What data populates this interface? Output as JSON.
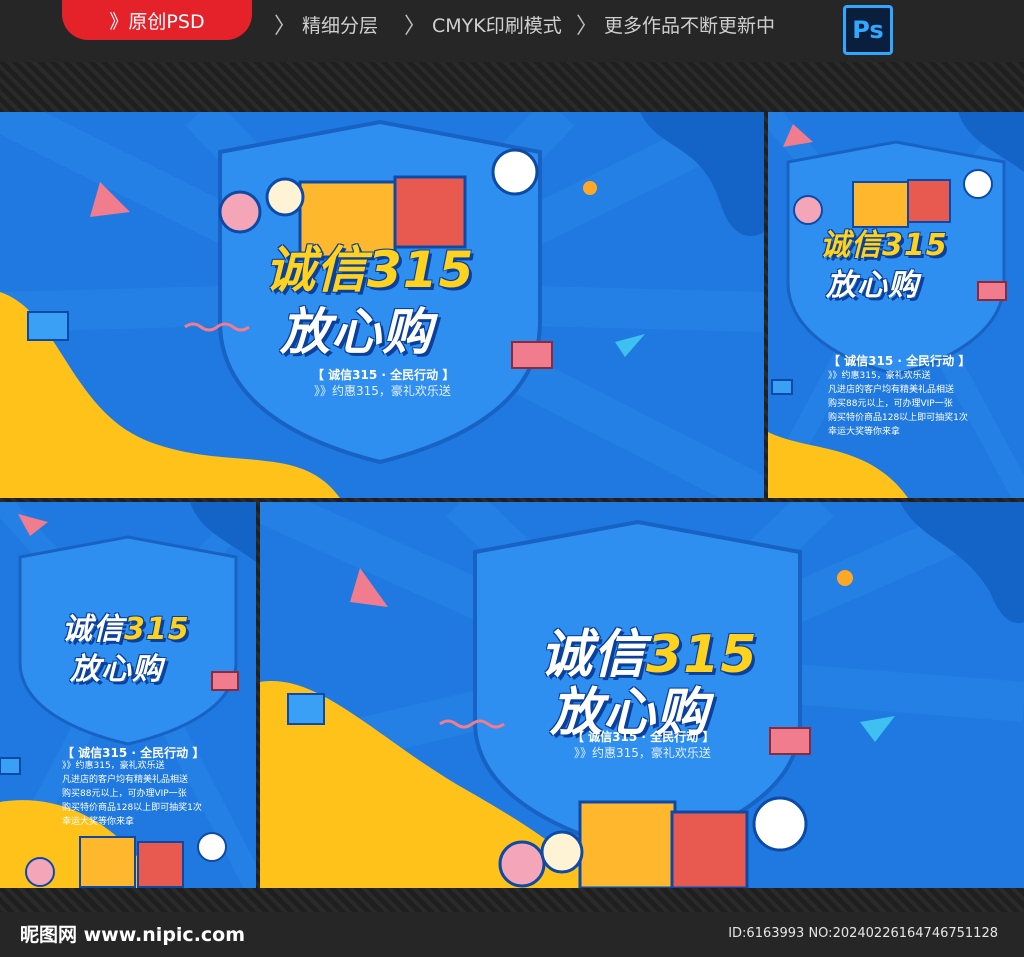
{
  "header": {
    "badge": "》原创PSD",
    "features": [
      "精细分层",
      "CMYK印刷模式",
      "更多作品不断更新中"
    ],
    "ps_label": "Ps"
  },
  "poster": {
    "title_a": "诚信",
    "title_b": "315",
    "title_line2": "放心购",
    "subtitle": "【 诚信315 · 全民行动 】",
    "tagline": "》》约惠315，豪礼欢乐送",
    "list": [
      "》》约惠315，豪礼欢乐送",
      "凡进店的客户均有精美礼品相送",
      "购买88元以上，可办理VIP一张",
      "购买特价商品128以上即可抽奖1次",
      "幸运大奖等你来拿"
    ]
  },
  "footer": {
    "logo": "昵图网 www.nipic.com",
    "image_id": "ID:6163993 NO:20240226164746751128"
  },
  "colors": {
    "panel_blue": "#1f79e0",
    "shield_blue": "#2e8ff0",
    "yellow": "#ffc21a",
    "pink": "#f07c8e",
    "red_badge": "#e5222a"
  }
}
